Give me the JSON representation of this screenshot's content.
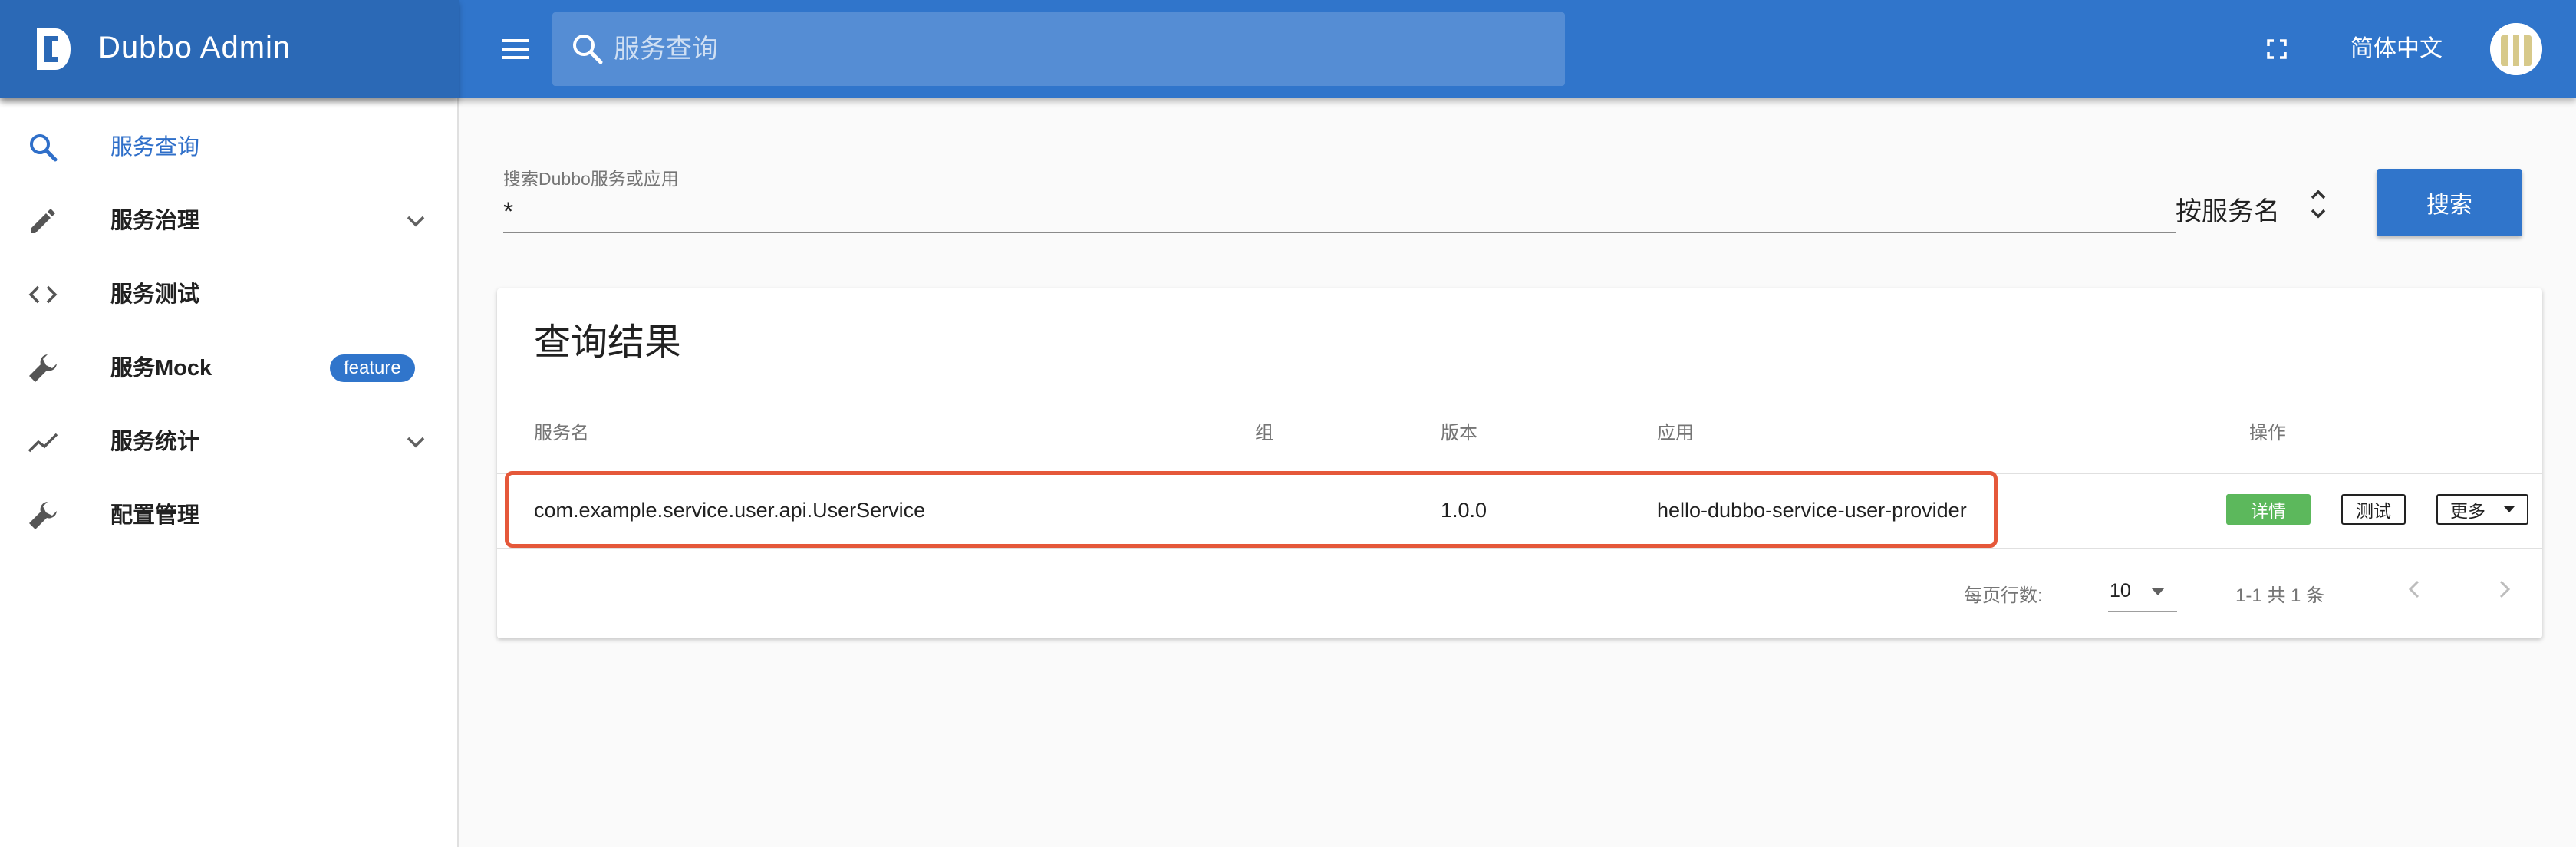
{
  "app": {
    "title": "Dubbo Admin"
  },
  "header": {
    "search_placeholder": "服务查询",
    "language": "简体中文"
  },
  "sidebar": {
    "items": [
      {
        "label": "服务查询",
        "icon": "search-icon",
        "active": true
      },
      {
        "label": "服务治理",
        "icon": "pencil-icon",
        "expandable": true
      },
      {
        "label": "服务测试",
        "icon": "code-icon"
      },
      {
        "label": "服务Mock",
        "icon": "wrench-icon",
        "badge": "feature"
      },
      {
        "label": "服务统计",
        "icon": "trending-up-icon",
        "expandable": true
      },
      {
        "label": "配置管理",
        "icon": "wrench-icon"
      }
    ]
  },
  "search_form": {
    "label": "搜索Dubbo服务或应用",
    "value": "*",
    "type_selected": "按服务名",
    "button": "搜索"
  },
  "results": {
    "title": "查询结果",
    "columns": [
      "服务名",
      "组",
      "版本",
      "应用",
      "操作"
    ],
    "rows": [
      {
        "service": "com.example.service.user.api.UserService",
        "group": "",
        "version": "1.0.0",
        "application": "hello-dubbo-service-user-provider",
        "actions": {
          "detail": "详情",
          "test": "测试",
          "more": "更多"
        }
      }
    ],
    "pagination": {
      "rows_per_page_label": "每页行数:",
      "rows_per_page": "10",
      "range": "1-1 共 1 条"
    }
  },
  "colors": {
    "appbar": "#3075cb",
    "brand": "#2b69b6",
    "active_nav": "#2f6fc9",
    "detail_button": "#5cb85c",
    "highlight_border": "#e5583a"
  }
}
